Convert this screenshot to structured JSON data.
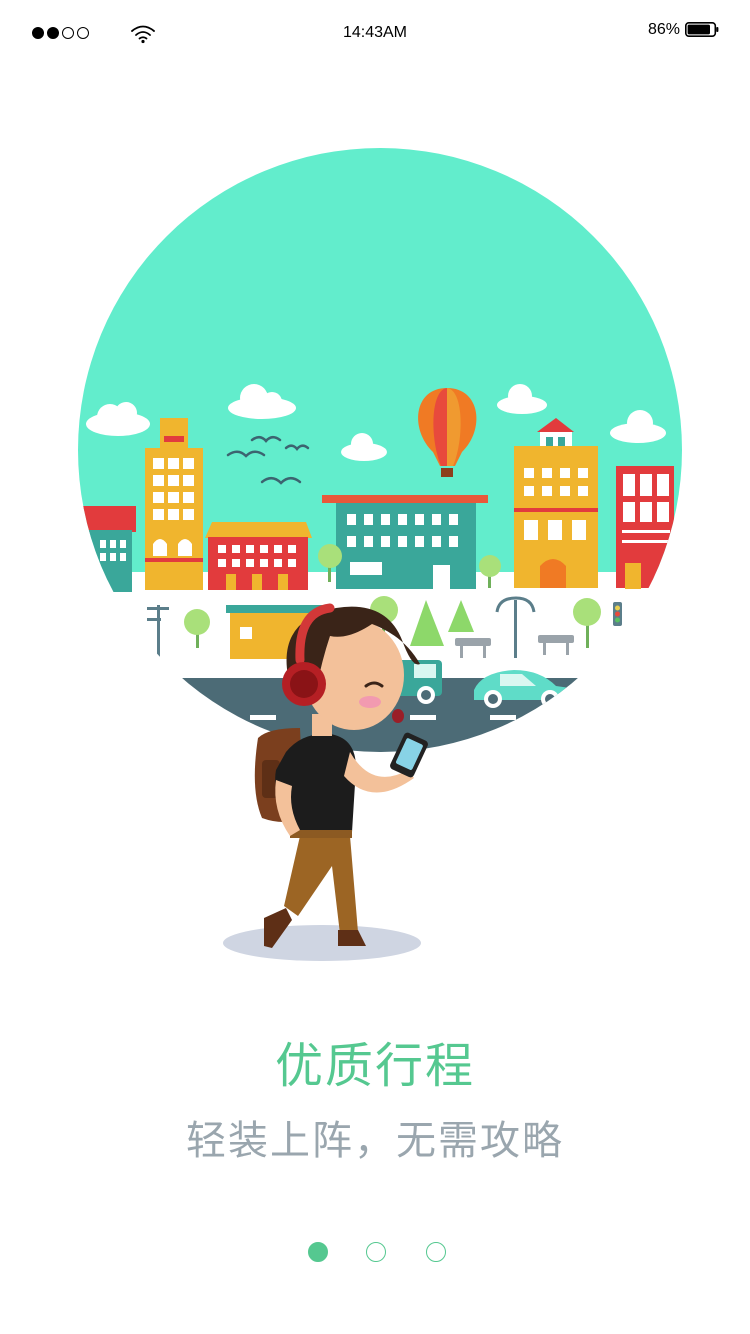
{
  "status_bar": {
    "time": "14:43AM",
    "battery_percent": "86%",
    "battery_level": 0.86,
    "signal_strength": 2,
    "signal_total": 4
  },
  "onboarding": {
    "title": "优质行程",
    "subtitle": "轻装上阵，无需攻略",
    "page_count": 3,
    "active_page": 1
  },
  "colors": {
    "accent": "#55c890",
    "sky": "#62edcc",
    "subtitle": "#9aa6ae"
  },
  "icons": [
    "signal-dots-icon",
    "wifi-icon",
    "battery-icon"
  ]
}
